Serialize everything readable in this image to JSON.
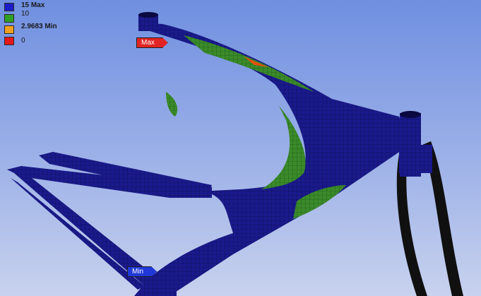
{
  "legend": {
    "items": [
      {
        "label": "15 Max",
        "color": "#1c1cc8"
      },
      {
        "label": "10",
        "color": "#2fa024"
      },
      {
        "label": "2.9683 Min",
        "color": "#f0a020"
      },
      {
        "label": "0",
        "color": "#e41818"
      }
    ]
  },
  "probes": {
    "max": {
      "label": "Max",
      "color": "#e02424"
    },
    "min": {
      "label": "Min",
      "color": "#2038d8"
    }
  },
  "colors": {
    "background_top": "#6f8fe0",
    "background_bottom": "#c8d2ee",
    "mesh_base": "#1a1a8c",
    "mesh_line": "#0a0a40",
    "highlight_green": "#3a8a2a",
    "tube_dark": "#101010"
  }
}
